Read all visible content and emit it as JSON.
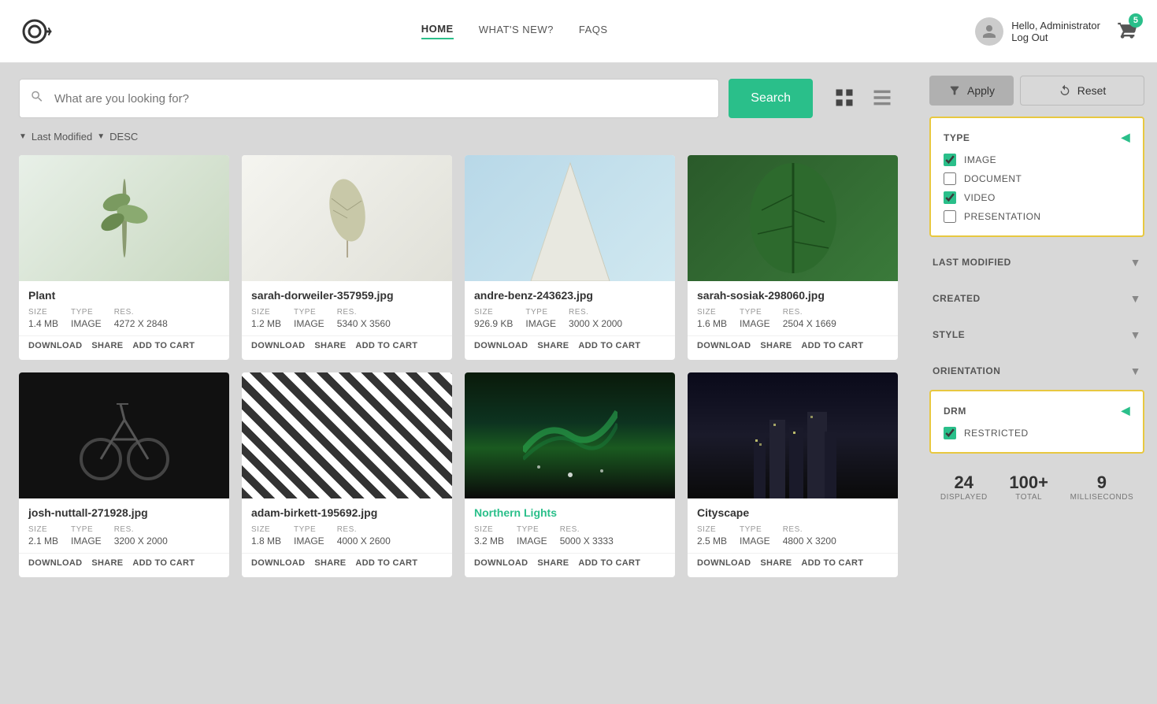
{
  "header": {
    "logo_text": "c:",
    "nav_items": [
      {
        "label": "HOME",
        "active": true
      },
      {
        "label": "WHAT'S NEW?",
        "active": false
      },
      {
        "label": "FAQS",
        "active": false
      }
    ],
    "user": {
      "greeting": "Hello, Administrator",
      "logout": "Log Out"
    },
    "cart_badge": "5"
  },
  "search": {
    "placeholder": "What are you looking for?",
    "button_label": "Search"
  },
  "sort": {
    "field_label": "Last Modified",
    "order_label": "DESC"
  },
  "media_items": [
    {
      "id": 1,
      "title": "Plant",
      "thumb_class": "thumb-plant",
      "size": "1.4 MB",
      "type": "IMAGE",
      "res": "4272 X 2848",
      "title_teal": false
    },
    {
      "id": 2,
      "title": "sarah-dorweiler-357959.jpg",
      "thumb_class": "thumb-leaf",
      "size": "1.2 MB",
      "type": "IMAGE",
      "res": "5340 X 3560",
      "title_teal": false
    },
    {
      "id": 3,
      "title": "andre-benz-243623.jpg",
      "thumb_class": "thumb-building",
      "size": "926.9 KB",
      "type": "IMAGE",
      "res": "3000 X 2000",
      "title_teal": false
    },
    {
      "id": 4,
      "title": "sarah-sosiak-298060.jpg",
      "thumb_class": "thumb-bigLeaf",
      "size": "1.6 MB",
      "type": "IMAGE",
      "res": "2504 X 1669",
      "title_teal": false
    },
    {
      "id": 5,
      "title": "josh-nuttall-271928.jpg",
      "thumb_class": "thumb-bike",
      "size": "2.1 MB",
      "type": "IMAGE",
      "res": "3200 X 2000",
      "title_teal": false
    },
    {
      "id": 6,
      "title": "adam-birkett-195692.jpg",
      "thumb_class": "thumb-stripes",
      "size": "1.8 MB",
      "type": "IMAGE",
      "res": "4000 X 2600",
      "title_teal": false
    },
    {
      "id": 7,
      "title": "Northern Lights",
      "thumb_class": "thumb-aurora",
      "size": "3.2 MB",
      "type": "IMAGE",
      "res": "5000 X 3333",
      "title_teal": true
    },
    {
      "id": 8,
      "title": "Cityscape",
      "thumb_class": "thumb-city",
      "size": "2.5 MB",
      "type": "IMAGE",
      "res": "4800 X 3200",
      "title_teal": false
    }
  ],
  "actions": {
    "download": "DOWNLOAD",
    "share": "SHARE",
    "add_to_cart": "ADD TO CART"
  },
  "meta_labels": {
    "size": "SIZE",
    "type": "TYPE",
    "res": "RES."
  },
  "filter": {
    "apply_label": "Apply",
    "reset_label": "Reset",
    "type_section": {
      "title": "TYPE",
      "options": [
        {
          "label": "IMAGE",
          "checked": true
        },
        {
          "label": "DOCUMENT",
          "checked": false
        },
        {
          "label": "VIDEO",
          "checked": true
        },
        {
          "label": "PRESENTATION",
          "checked": false
        }
      ]
    },
    "last_modified_section": {
      "title": "LAST MODIFIED"
    },
    "created_section": {
      "title": "CREATED"
    },
    "style_section": {
      "title": "STYLE"
    },
    "orientation_section": {
      "title": "ORIENTATION"
    },
    "drm_section": {
      "title": "DRM",
      "options": [
        {
          "label": "Restricted",
          "checked": true
        }
      ]
    }
  },
  "stats": {
    "displayed": "24",
    "displayed_label": "DISPLAYED",
    "total": "100+",
    "total_label": "TOTAL",
    "milliseconds": "9",
    "milliseconds_label": "MILLISECONDS"
  }
}
